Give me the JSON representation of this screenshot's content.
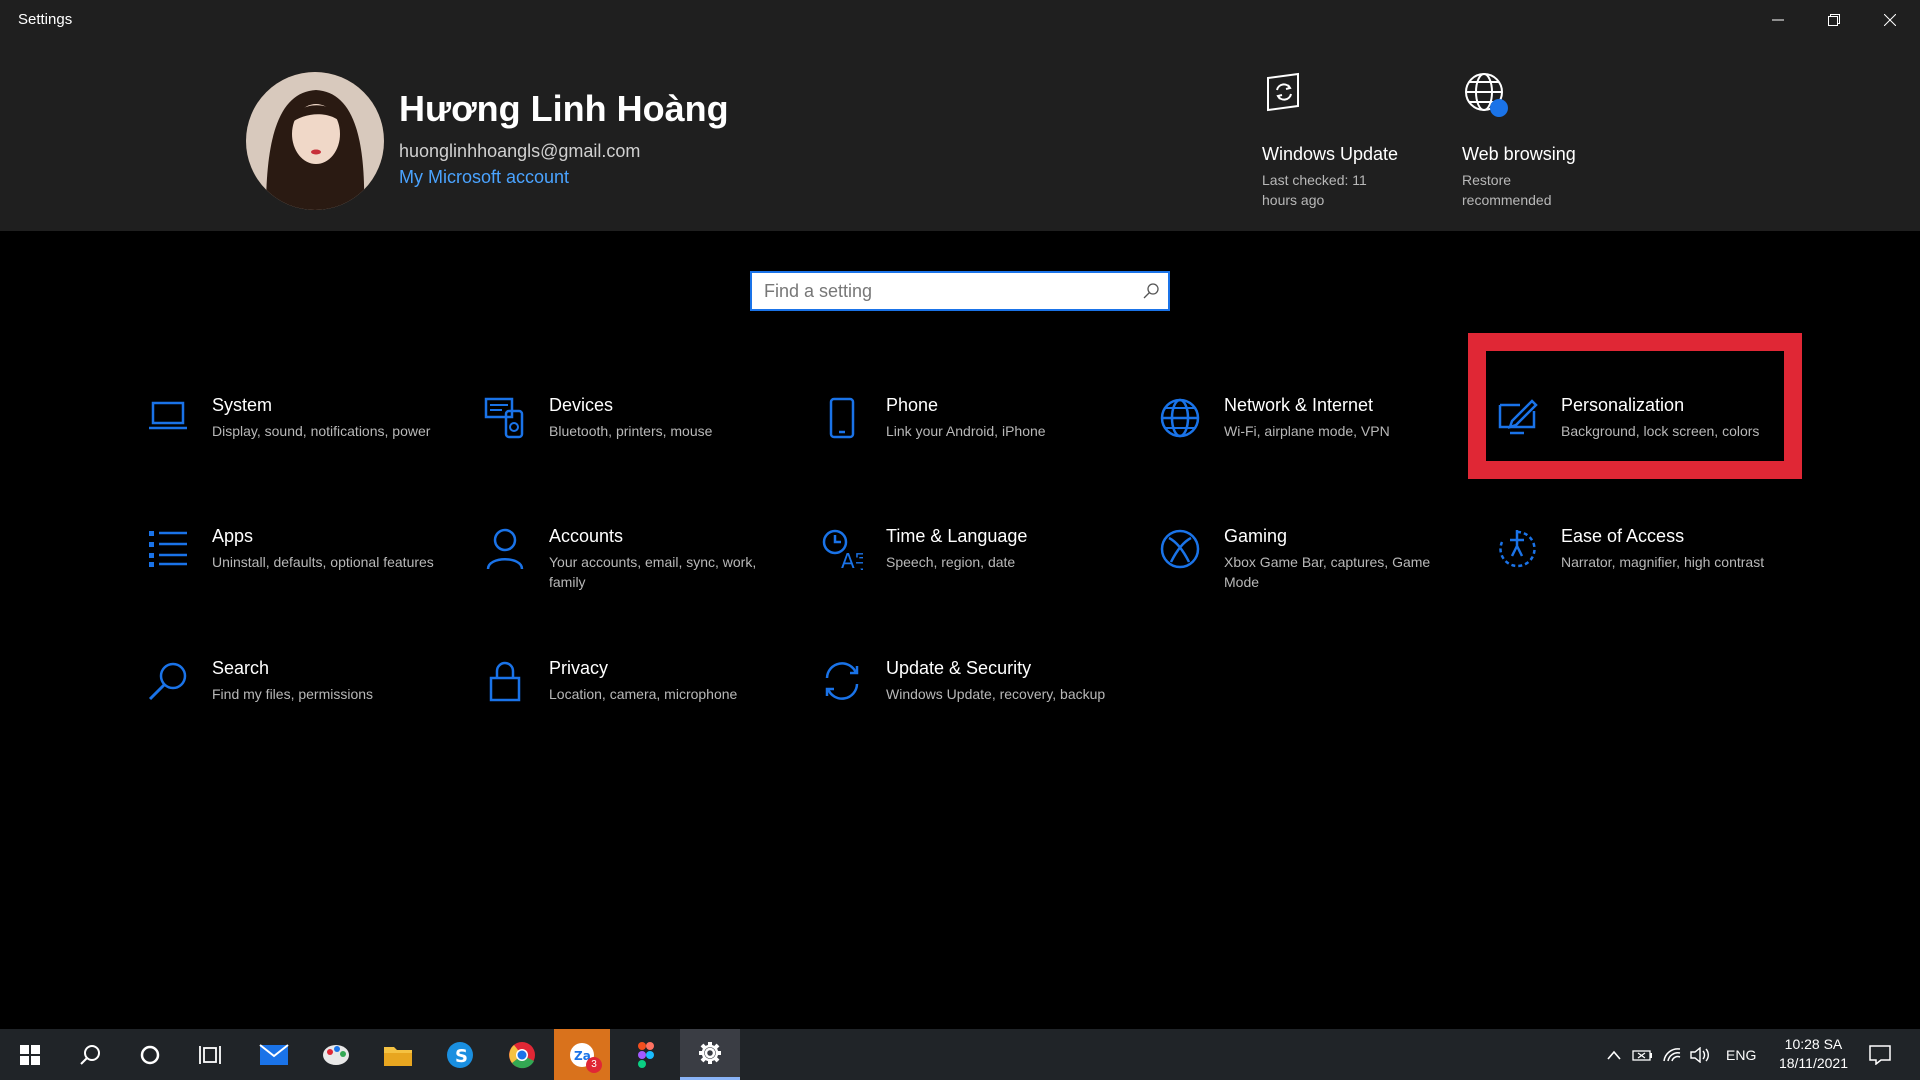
{
  "window": {
    "title": "Settings"
  },
  "profile": {
    "name": "Hương Linh Hoàng",
    "email": "huonglinhhoangls@gmail.com",
    "link": "My Microsoft account"
  },
  "status": [
    {
      "title": "Windows Update",
      "subtitle": "Last checked: 11 hours ago",
      "icon": "windows-update-icon"
    },
    {
      "title": "Web browsing",
      "subtitle": "Restore recommended",
      "icon": "web-browsing-icon"
    }
  ],
  "search": {
    "placeholder": "Find a setting"
  },
  "categories": [
    {
      "title": "System",
      "desc": "Display, sound, notifications, power",
      "icon": "laptop-icon"
    },
    {
      "title": "Devices",
      "desc": "Bluetooth, printers, mouse",
      "icon": "devices-icon"
    },
    {
      "title": "Phone",
      "desc": "Link your Android, iPhone",
      "icon": "phone-icon"
    },
    {
      "title": "Network & Internet",
      "desc": "Wi-Fi, airplane mode, VPN",
      "icon": "globe-icon"
    },
    {
      "title": "Personalization",
      "desc": "Background, lock screen, colors",
      "icon": "personalization-icon"
    },
    {
      "title": "Apps",
      "desc": "Uninstall, defaults, optional features",
      "icon": "apps-list-icon"
    },
    {
      "title": "Accounts",
      "desc": "Your accounts, email, sync, work, family",
      "icon": "person-icon"
    },
    {
      "title": "Time & Language",
      "desc": "Speech, region, date",
      "icon": "time-language-icon"
    },
    {
      "title": "Gaming",
      "desc": "Xbox Game Bar, captures, Game Mode",
      "icon": "xbox-icon"
    },
    {
      "title": "Ease of Access",
      "desc": "Narrator, magnifier, high contrast",
      "icon": "ease-of-access-icon"
    },
    {
      "title": "Search",
      "desc": "Find my files, permissions",
      "icon": "search-icon"
    },
    {
      "title": "Privacy",
      "desc": "Location, camera, microphone",
      "icon": "lock-icon"
    },
    {
      "title": "Update & Security",
      "desc": "Windows Update, recovery, backup",
      "icon": "sync-icon"
    }
  ],
  "taskbar": {
    "apps": [
      "start-icon",
      "search-icon",
      "cortana-icon",
      "task-view-icon",
      "mail-icon",
      "paint-icon",
      "file-explorer-icon",
      "skype-icon",
      "chrome-icon",
      "zalo-icon",
      "figma-icon",
      "settings-gear-icon"
    ],
    "zalo_badge": "3",
    "language": "ENG",
    "time": "10:28 SA",
    "date": "18/11/2021"
  },
  "colors": {
    "accent": "#1a73e8",
    "highlight": "#e02735",
    "header_bg": "#1f1f1f"
  }
}
